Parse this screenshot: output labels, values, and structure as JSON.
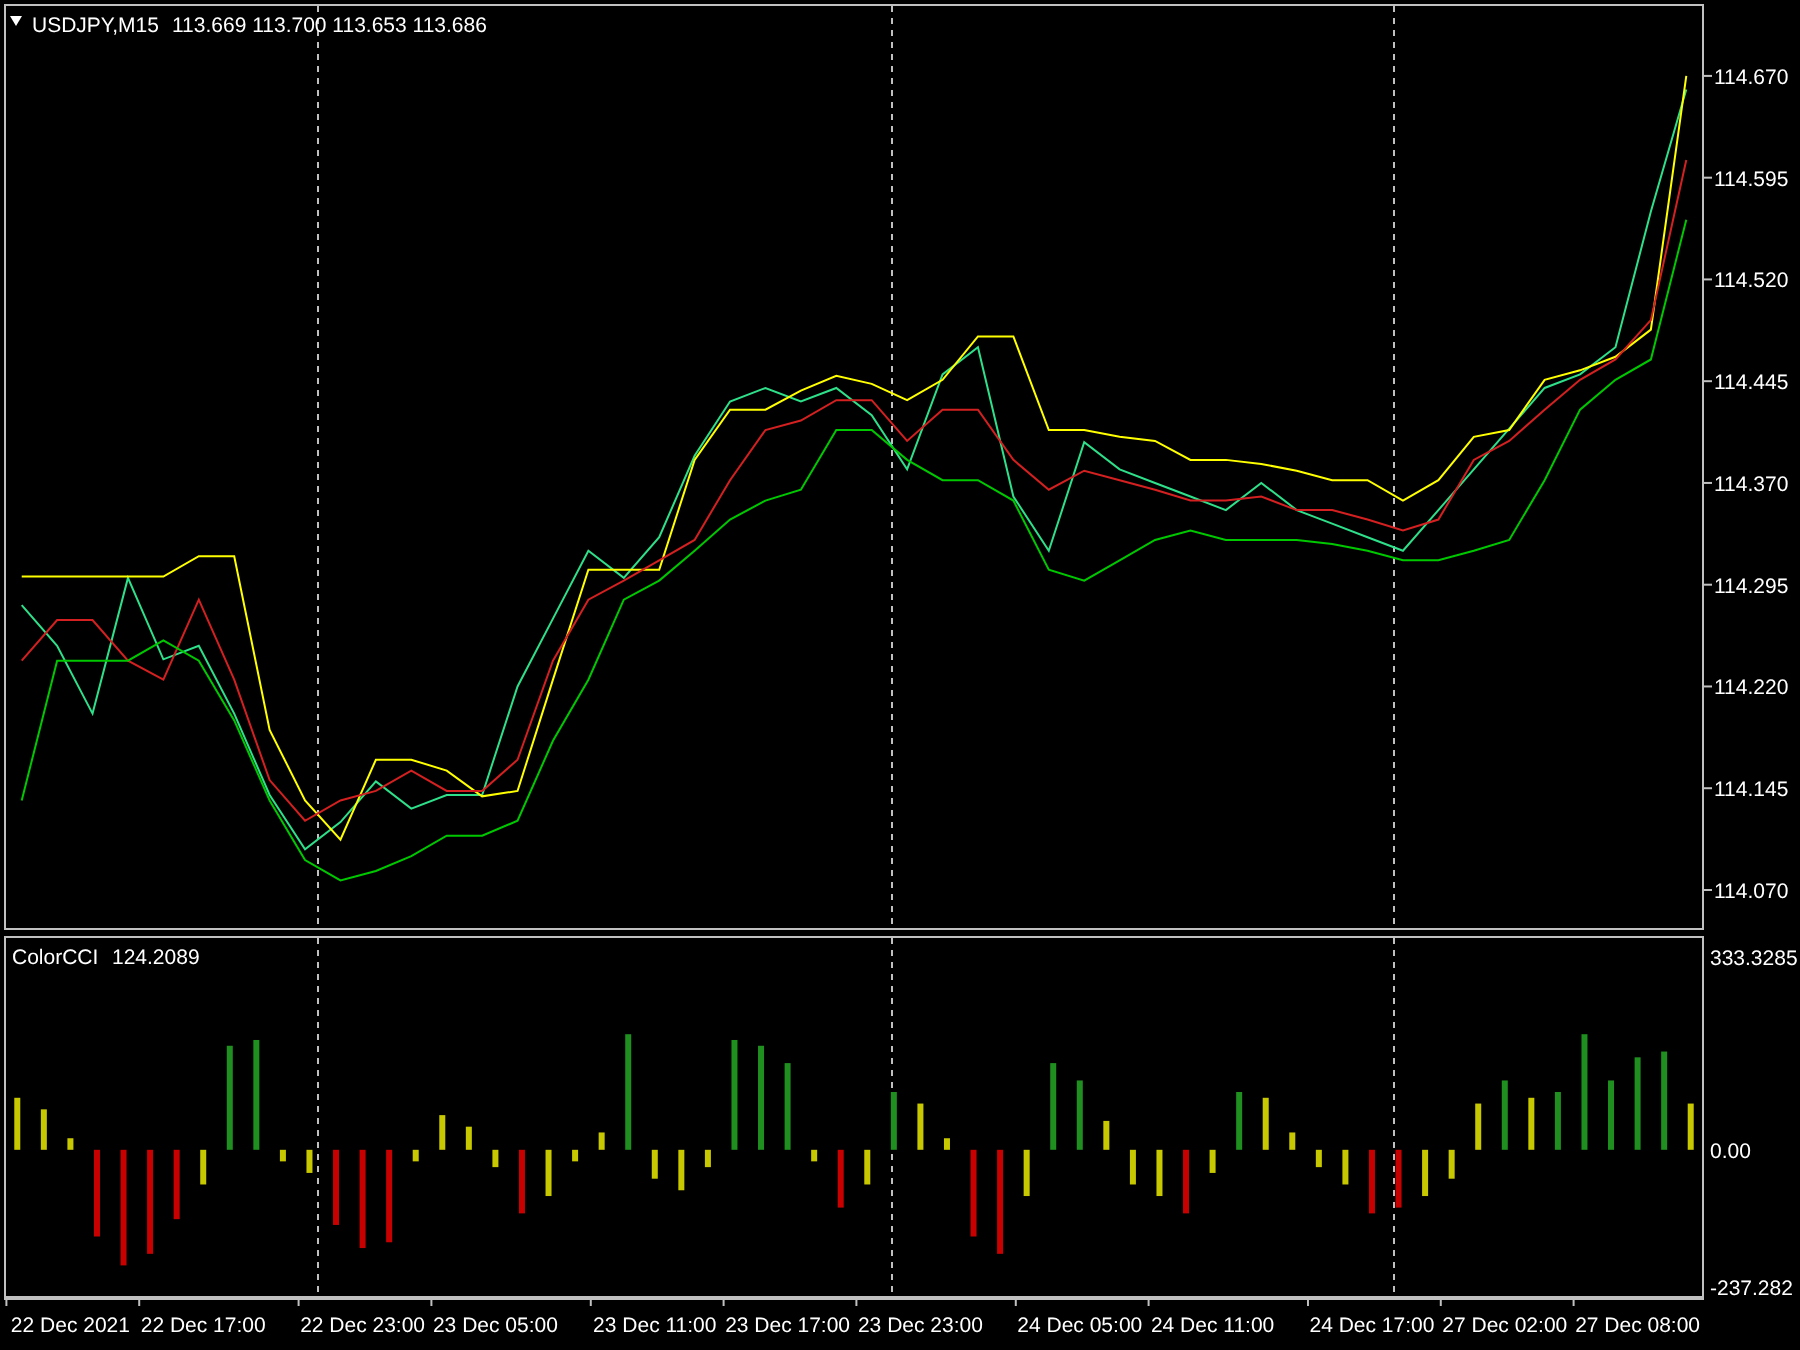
{
  "price_pane": {
    "symbol": "USDJPY,M15",
    "ohlc": "113.669 113.700 113.653 113.686",
    "chart_data": {
      "type": "line",
      "ylim": [
        114.0405,
        114.723
      ],
      "categories": [
        null,
        null,
        null,
        null,
        null,
        null,
        null,
        null,
        null,
        null,
        null,
        null,
        null,
        null,
        null,
        null,
        null,
        null,
        null,
        null,
        null,
        null,
        null,
        null,
        null,
        null,
        null,
        null,
        null,
        null,
        null,
        null,
        null,
        null,
        null,
        null,
        null,
        null,
        null,
        null,
        null,
        null,
        null,
        null,
        null,
        null,
        null,
        null
      ],
      "yticks": [
        {
          "value": 114.07,
          "label": "114.070"
        },
        {
          "value": 114.145,
          "label": "114.145"
        },
        {
          "value": 114.22,
          "label": "114.220"
        },
        {
          "value": 114.295,
          "label": "114.295"
        },
        {
          "value": 114.37,
          "label": "114.370"
        },
        {
          "value": 114.445,
          "label": "114.445"
        },
        {
          "value": 114.52,
          "label": "114.520"
        },
        {
          "value": 114.595,
          "label": "114.595"
        },
        {
          "value": 114.67,
          "label": "114.670"
        }
      ],
      "series": [
        {
          "color": "#2ee08a",
          "values": [
            114.28,
            114.25,
            114.2,
            114.3,
            114.24,
            114.25,
            114.2,
            114.14,
            114.1,
            114.12,
            114.15,
            114.13,
            114.14,
            114.14,
            114.22,
            114.27,
            114.32,
            114.3,
            114.33,
            114.39,
            114.43,
            114.44,
            114.43,
            114.44,
            114.42,
            114.38,
            114.45,
            114.47,
            114.36,
            114.32,
            114.4,
            114.38,
            114.37,
            114.36,
            114.35,
            114.37,
            114.35,
            114.34,
            114.33,
            114.32,
            114.35,
            114.38,
            114.41,
            114.44,
            114.45,
            114.47,
            114.57,
            114.66
          ]
        },
        {
          "color": "#ffff00",
          "values": [
            114.301,
            114.301,
            114.301,
            114.301,
            114.301,
            114.316,
            114.316,
            114.188,
            114.136,
            114.107,
            114.166,
            114.166,
            114.158,
            114.139,
            114.143,
            114.225,
            114.306,
            114.306,
            114.306,
            114.387,
            114.424,
            114.424,
            114.438,
            114.449,
            114.443,
            114.431,
            114.446,
            114.478,
            114.478,
            114.409,
            114.409,
            114.404,
            114.401,
            114.387,
            114.387,
            114.384,
            114.379,
            114.372,
            114.372,
            114.357,
            114.372,
            114.404,
            114.409,
            114.446,
            114.453,
            114.463,
            114.483,
            114.67
          ]
        },
        {
          "color": "#d42020",
          "values": [
            114.239,
            114.269,
            114.269,
            114.239,
            114.225,
            114.284,
            114.225,
            114.151,
            114.121,
            114.136,
            114.143,
            114.158,
            114.143,
            114.143,
            114.166,
            114.239,
            114.284,
            114.298,
            114.313,
            114.328,
            114.372,
            114.409,
            114.416,
            114.431,
            114.431,
            114.401,
            114.424,
            114.424,
            114.387,
            114.365,
            114.379,
            114.372,
            114.365,
            114.357,
            114.357,
            114.36,
            114.35,
            114.35,
            114.343,
            114.335,
            114.343,
            114.387,
            114.401,
            114.424,
            114.446,
            114.461,
            114.49,
            114.608
          ]
        },
        {
          "color": "#00c800",
          "values": [
            114.136,
            114.239,
            114.239,
            114.239,
            114.254,
            114.239,
            114.195,
            114.136,
            114.092,
            114.077,
            114.084,
            114.095,
            114.11,
            114.11,
            114.121,
            114.18,
            114.225,
            114.284,
            114.298,
            114.32,
            114.343,
            114.357,
            114.365,
            114.409,
            114.409,
            114.387,
            114.372,
            114.372,
            114.357,
            114.306,
            114.298,
            114.313,
            114.328,
            114.335,
            114.328,
            114.328,
            114.328,
            114.325,
            114.32,
            114.313,
            114.313,
            114.32,
            114.328,
            114.372,
            114.424,
            114.446,
            114.461,
            114.564
          ]
        }
      ]
    }
  },
  "cci_pane": {
    "name": "ColorCCI",
    "value": "124.2089",
    "chart_data": {
      "type": "bar",
      "ylim": [
        -256.4,
        369.9
      ],
      "categories": [
        null,
        null,
        "22 Dec 2021",
        null,
        null,
        null,
        null,
        "22 Dec 17:00",
        null,
        null,
        null,
        null,
        null,
        "22 Dec 23:00",
        null,
        null,
        null,
        null,
        "23 Dec 05:00",
        null,
        null,
        null,
        null,
        null,
        "23 Dec 11:00",
        null,
        null,
        null,
        null,
        "23 Dec 17:00",
        null,
        null,
        null,
        null,
        "23 Dec 23:00",
        null,
        null,
        null,
        null,
        null,
        "24 Dec 05:00",
        null,
        null,
        null,
        null,
        "24 Dec 11:00",
        null,
        null,
        null,
        null,
        null,
        "24 Dec 17:00",
        null,
        null,
        null,
        null,
        "27 Dec 02:00",
        null,
        null,
        null,
        null,
        "27 Dec 08:00",
        null,
        null
      ],
      "yticks": [
        {
          "value": 333.3285,
          "label": "333.3285"
        },
        {
          "value": 0,
          "label": "0.00"
        },
        {
          "value": -237.282,
          "label": "-237.282"
        }
      ],
      "series": [
        {
          "values": [
            90,
            70,
            20,
            -150,
            -200,
            -180,
            -120,
            -60,
            180,
            190,
            -20,
            -40,
            -130,
            -170,
            -160,
            -20,
            60,
            40,
            -30,
            -110,
            -80,
            -20,
            30,
            200,
            -50,
            -70,
            -30,
            190,
            180,
            150,
            -20,
            -100,
            -60,
            100,
            80,
            20,
            -150,
            -180,
            -80,
            150,
            120,
            50,
            -60,
            -80,
            -110,
            -40,
            100,
            90,
            30,
            -30,
            -60,
            -110,
            -100,
            -80,
            -50,
            80,
            120,
            90,
            100,
            200,
            120,
            160,
            170,
            80
          ]
        }
      ]
    }
  }
}
